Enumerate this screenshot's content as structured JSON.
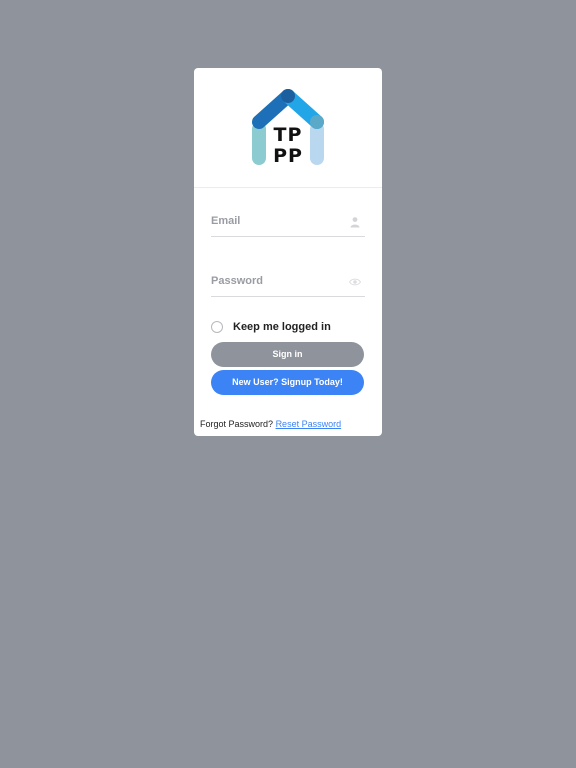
{
  "brand": {
    "logo_line1": "TP",
    "logo_line2": "PP"
  },
  "form": {
    "email_placeholder": "Email",
    "email_value": "",
    "password_placeholder": "Password",
    "password_value": "",
    "remember_label": "Keep me logged in",
    "remember_checked": false,
    "signin_label": "Sign in",
    "signup_label": "New User? Signup Today!",
    "forgot_text": "Forgot Password?",
    "reset_link": "Reset Password"
  },
  "icons": {
    "email": "user-icon",
    "password": "eye-icon"
  },
  "colors": {
    "background": "#8f939b",
    "primary": "#3c84f5",
    "disabled_button": "#8f939b",
    "logo_dark_blue": "#1d6fb8",
    "logo_light_blue": "#22a6e8",
    "logo_teal": "#8ccbd0",
    "logo_pale_blue": "#b9d7ee"
  }
}
